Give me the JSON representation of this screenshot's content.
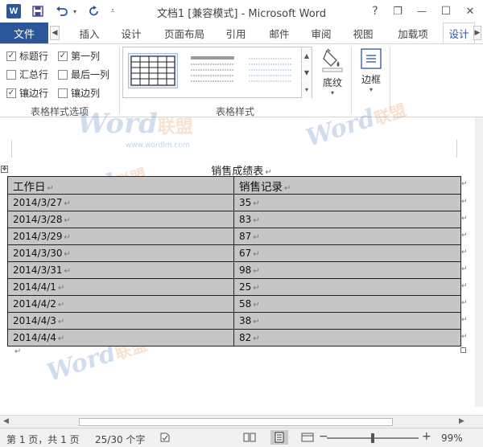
{
  "window": {
    "title": "文档1 [兼容模式] - Microsoft Word",
    "logo": "W",
    "help": "?",
    "restore": "❐",
    "minimize": "—",
    "maximize": "☐",
    "close": "✕"
  },
  "quick_access": {
    "save_icon": "save-icon",
    "undo_icon": "undo-icon",
    "redo_icon": "redo-icon",
    "customize_icon": "customize-icon"
  },
  "tabs": {
    "file": "文件",
    "items": [
      "插入",
      "设计",
      "页面布局",
      "引用",
      "邮件",
      "审阅",
      "视图",
      "加载项",
      "设计"
    ],
    "active_index": 8
  },
  "ribbon": {
    "style_options": {
      "header_row": {
        "label": "标题行",
        "checked": true
      },
      "total_row": {
        "label": "汇总行",
        "checked": false
      },
      "banded_rows": {
        "label": "镶边行",
        "checked": true
      },
      "first_column": {
        "label": "第一列",
        "checked": true
      },
      "last_column": {
        "label": "最后一列",
        "checked": false
      },
      "banded_columns": {
        "label": "镶边列",
        "checked": false
      },
      "group_label": "表格样式选项"
    },
    "table_styles": {
      "group_label": "表格样式"
    },
    "shading": {
      "label": "底纹"
    },
    "borders": {
      "label": "边框"
    }
  },
  "document": {
    "table_title": "销售成绩表",
    "headers": [
      "工作日",
      "销售记录"
    ],
    "rows": [
      [
        "2014/3/27",
        "35"
      ],
      [
        "2014/3/28",
        "83"
      ],
      [
        "2014/3/29",
        "87"
      ],
      [
        "2014/3/30",
        "67"
      ],
      [
        "2014/3/31",
        "98"
      ],
      [
        "2014/4/1",
        "25"
      ],
      [
        "2014/4/2",
        "58"
      ],
      [
        "2014/4/3",
        "38"
      ],
      [
        "2014/4/4",
        "82"
      ]
    ]
  },
  "watermark": {
    "word": "Word",
    "lianmeng": "联盟",
    "url": "www.wordlm.com"
  },
  "status": {
    "page": "第 1 页，共 1 页",
    "words": "25/30 个字",
    "zoom": "99%",
    "zoom_level": 0.5,
    "minus": "−",
    "plus": "+"
  }
}
